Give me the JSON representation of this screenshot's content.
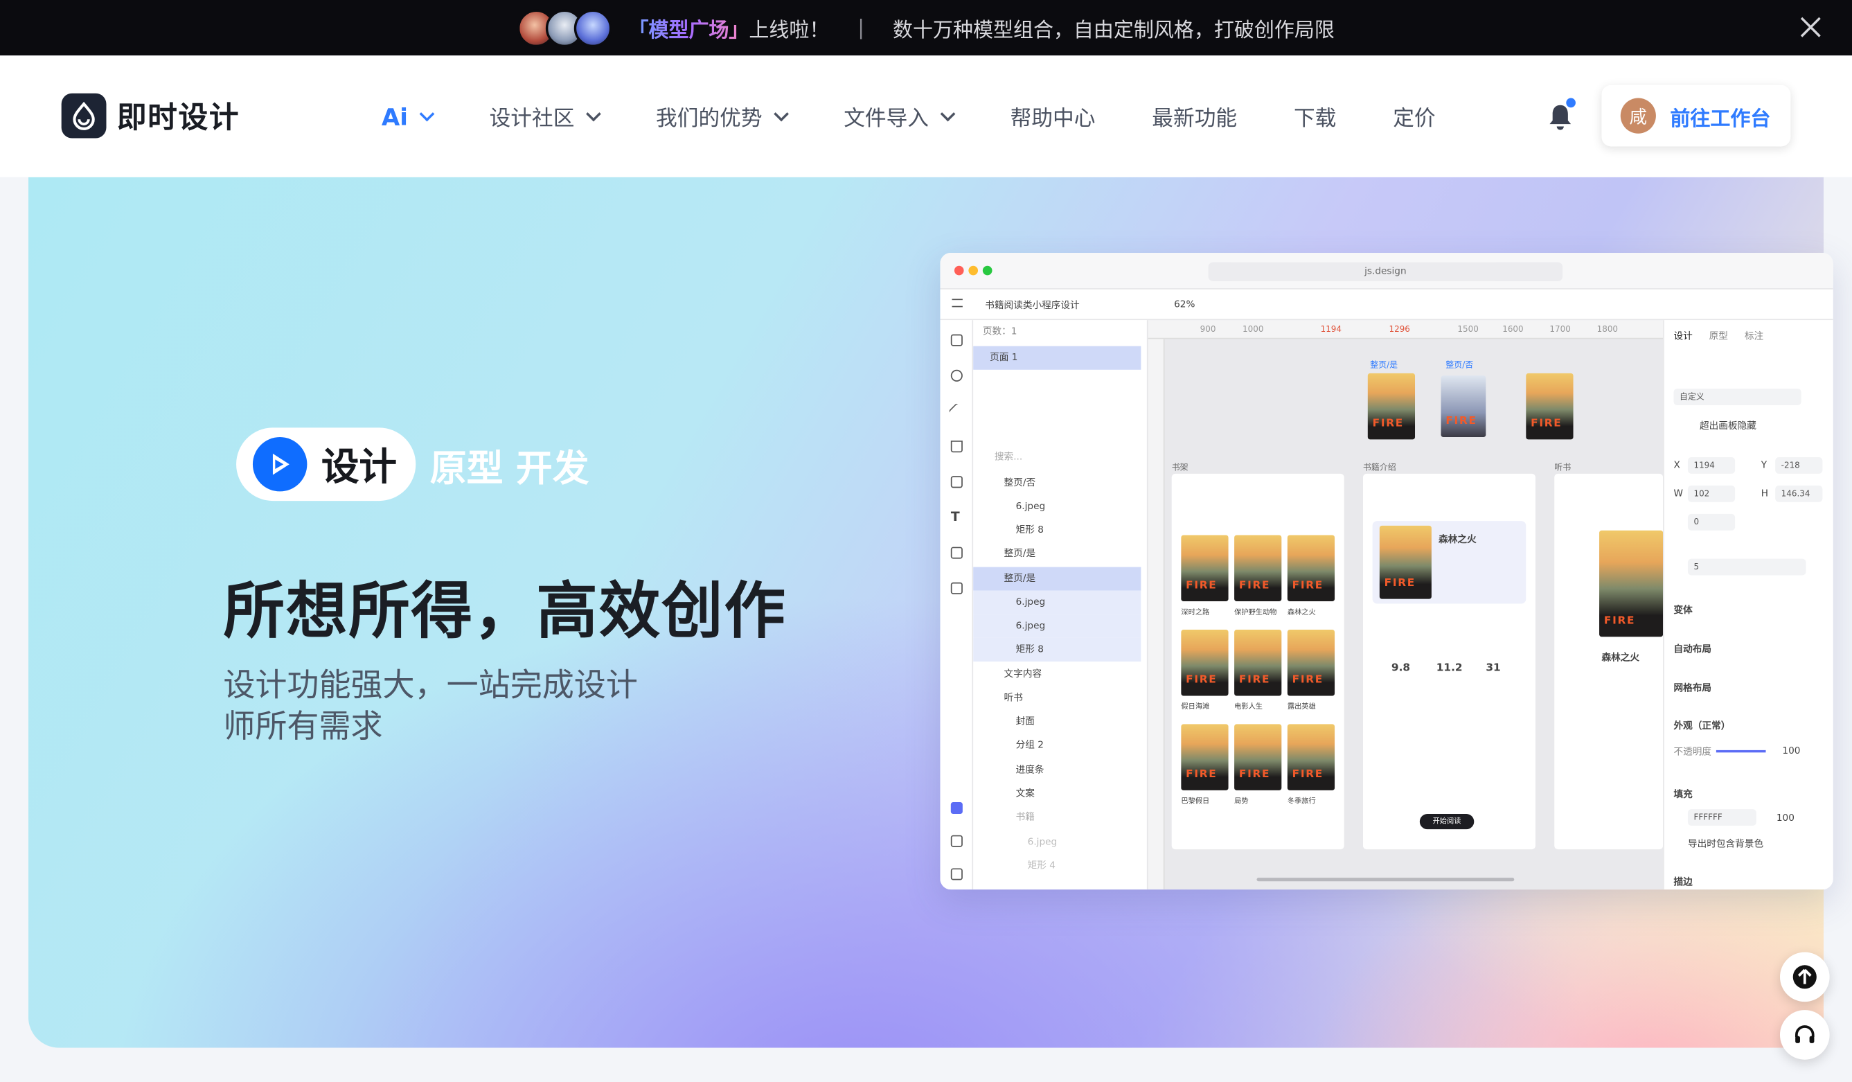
{
  "promo": {
    "highlight": "「模型广场」",
    "launch": "上线啦！",
    "separator": "|",
    "message": "数十万种模型组合，自由定制风格，打破创作局限"
  },
  "nav": {
    "brand": "即时设计",
    "items": [
      {
        "label": "Ai",
        "has_dropdown": true
      },
      {
        "label": "设计社区",
        "has_dropdown": true
      },
      {
        "label": "我们的优势",
        "has_dropdown": true
      },
      {
        "label": "文件导入",
        "has_dropdown": true
      },
      {
        "label": "帮助中心"
      },
      {
        "label": "最新功能"
      },
      {
        "label": "下载"
      },
      {
        "label": "定价"
      }
    ],
    "avatar_initial": "咸",
    "cta": "前往工作台"
  },
  "hero": {
    "tab_active": "设计",
    "tab_rest": "原型 开发",
    "headline": "所想所得，高效创作",
    "subline": "设计功能强大，一站完成设计师所有需求"
  },
  "app": {
    "url": "js.design",
    "file_name": "书籍阅读类小程序设计",
    "zoom": "62%",
    "pages_label": "页数：1",
    "page_name": "页面 1",
    "search_placeholder": "搜索...",
    "layers": [
      "整页/否",
      "6.jpeg",
      "矩形 8",
      "整页/是",
      "整页/是",
      "6.jpeg",
      "6.jpeg",
      "矩形 8",
      "文字内容",
      "听书",
      "封面",
      "分组 2",
      "进度条",
      "文案",
      "书籍",
      "6.jpeg",
      "矩形 4"
    ],
    "ruler_ticks": [
      "900",
      "1000",
      "1194",
      "1296",
      "1500",
      "1600",
      "1700",
      "1800"
    ],
    "frames": [
      "书架",
      "书籍介绍",
      "听书"
    ],
    "variant_labels": [
      "整页/是",
      "整页/否"
    ],
    "book_titles": [
      "深时之路",
      "保护野生动物",
      "森林之火",
      "假日海滩",
      "电影人生",
      "露出英雄",
      "巴黎假日",
      "局势",
      "冬季旅行"
    ],
    "detail": {
      "title": "森林之火",
      "rating": "9.8",
      "readers": "11.2",
      "words": "31",
      "start": "开始阅读"
    },
    "props": {
      "tabs": [
        "设计",
        "原型",
        "标注"
      ],
      "preset": "自定义",
      "clip": "超出画板隐藏",
      "x": "1194",
      "y": "-218",
      "w": "102",
      "h": "146.34",
      "rotation": "0",
      "radius": "5",
      "sections": [
        "变体",
        "自动布局",
        "网格布局",
        "外观（正常）",
        "不透明度",
        "填充",
        "描边"
      ],
      "opacity": "100",
      "fill_hex": "FFFFFF",
      "fill_opacity": "100",
      "export_bg": "导出时包含背景色"
    }
  },
  "colors": {
    "accent": "#2f7bff",
    "promo_bg": "#0b0b0f",
    "brand_dark": "#1d2434"
  }
}
